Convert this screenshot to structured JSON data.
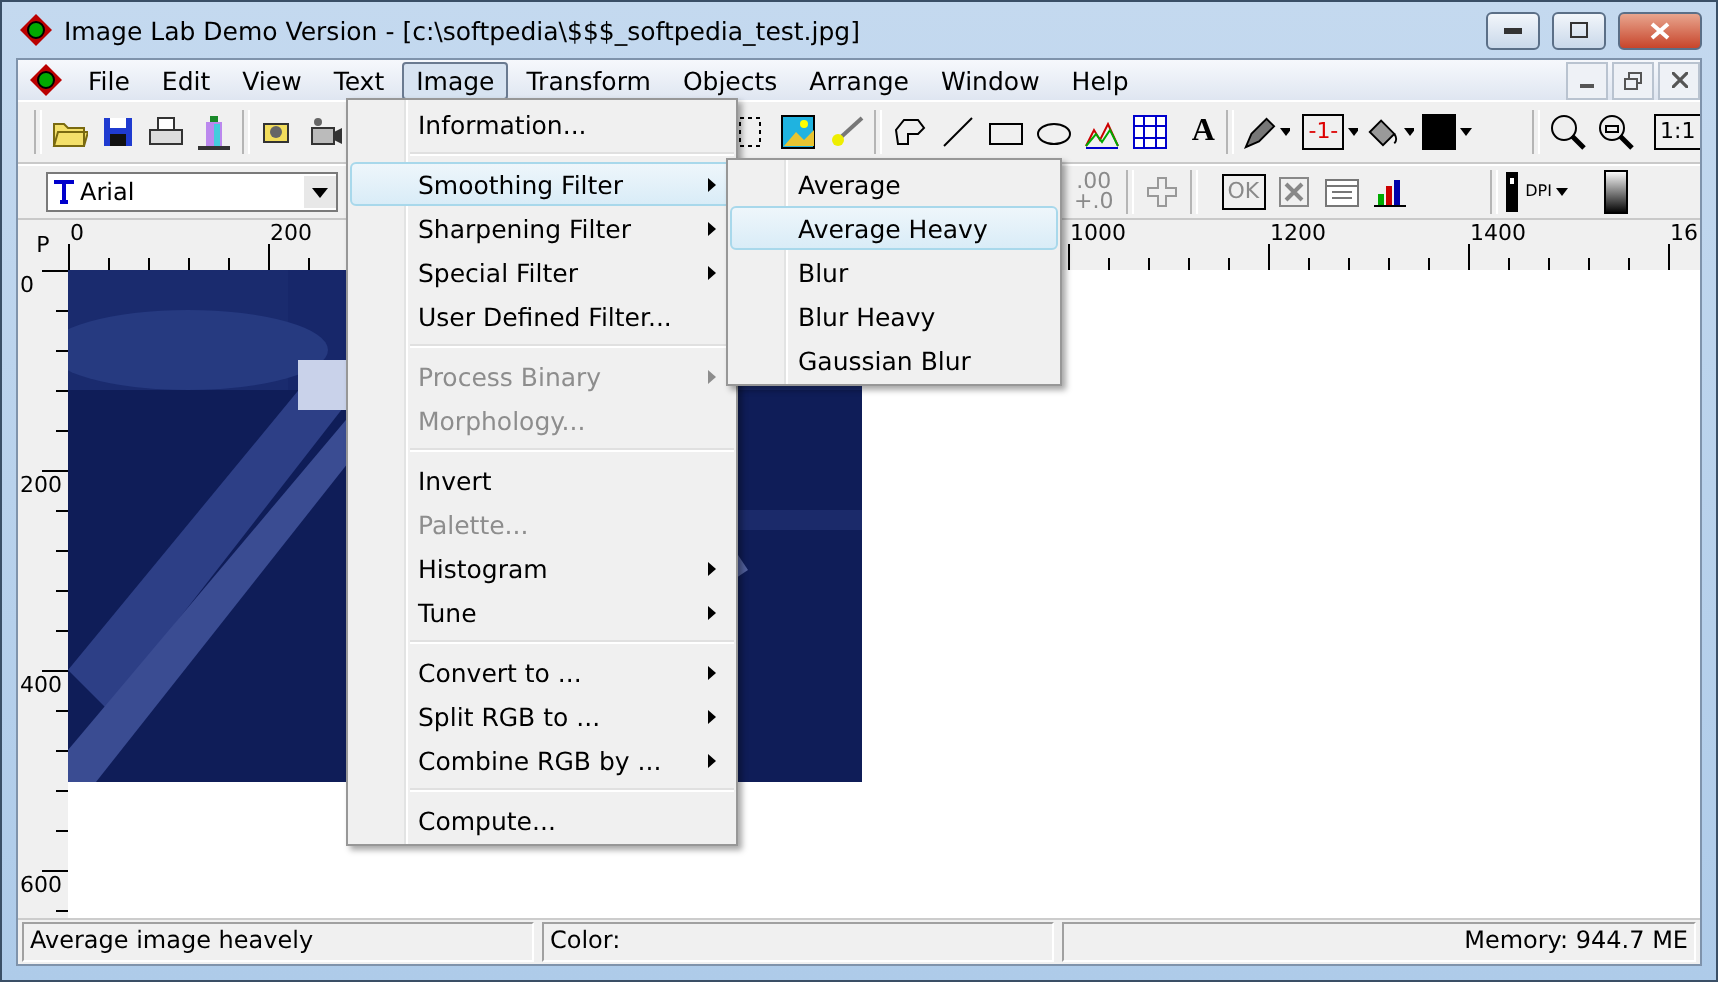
{
  "window": {
    "title": "Image Lab Demo Version - [c:\\softpedia\\$$$_softpedia_test.jpg]"
  },
  "menu_bar": [
    {
      "label": "File",
      "selected": false
    },
    {
      "label": "Edit",
      "selected": false
    },
    {
      "label": "View",
      "selected": false
    },
    {
      "label": "Text",
      "selected": false
    },
    {
      "label": "Image",
      "selected": true
    },
    {
      "label": "Transform",
      "selected": false
    },
    {
      "label": "Objects",
      "selected": false
    },
    {
      "label": "Arrange",
      "selected": false
    },
    {
      "label": "Window",
      "selected": false
    },
    {
      "label": "Help",
      "selected": false
    }
  ],
  "toolbar_top": [
    {
      "kind": "open"
    },
    {
      "kind": "save"
    },
    {
      "kind": "print"
    },
    {
      "kind": "scanner"
    },
    {
      "kind": "sep"
    },
    {
      "kind": "camera"
    },
    {
      "kind": "camcorder"
    },
    {
      "kind": "gap"
    },
    {
      "kind": "select"
    },
    {
      "kind": "picture"
    },
    {
      "kind": "wand"
    },
    {
      "kind": "sep"
    },
    {
      "kind": "lasso"
    },
    {
      "kind": "line"
    },
    {
      "kind": "rect"
    },
    {
      "kind": "ellipse"
    },
    {
      "kind": "histogram"
    },
    {
      "kind": "grid"
    },
    {
      "kind": "text",
      "label": "A"
    },
    {
      "kind": "sep"
    },
    {
      "kind": "pen",
      "dropdown": true
    },
    {
      "kind": "width",
      "label": "-1-",
      "dropdown": true
    },
    {
      "kind": "fill",
      "dropdown": true
    },
    {
      "kind": "swatch",
      "dropdown": true
    },
    {
      "kind": "grip"
    },
    {
      "kind": "zoomin"
    },
    {
      "kind": "zoomout"
    },
    {
      "kind": "actual",
      "label": "1:1"
    }
  ],
  "font_box": {
    "value": "Arial"
  },
  "toolbar_second": [
    {
      "kind": "decimal",
      "label": ".00 +.0"
    },
    {
      "kind": "grip"
    },
    {
      "kind": "cross"
    },
    {
      "kind": "sep"
    },
    {
      "kind": "ok",
      "label": "OK"
    },
    {
      "kind": "cancel"
    },
    {
      "kind": "window"
    },
    {
      "kind": "chart"
    },
    {
      "kind": "grip"
    },
    {
      "kind": "dpi",
      "label": "DPI",
      "dropdown": true
    },
    {
      "kind": "gradient"
    }
  ],
  "ruler": {
    "corner": "P",
    "top_labels": [
      "0",
      "200",
      "1000",
      "1200",
      "1400",
      "16"
    ],
    "left_labels": [
      "0",
      "200",
      "400",
      "600"
    ]
  },
  "image_menu": [
    {
      "kind": "item",
      "label": "Information...",
      "submenu": false,
      "disabled": false,
      "selected": false
    },
    {
      "kind": "separator"
    },
    {
      "kind": "item",
      "label": "Smoothing Filter",
      "submenu": true,
      "disabled": false,
      "selected": true
    },
    {
      "kind": "item",
      "label": "Sharpening Filter",
      "submenu": true,
      "disabled": false,
      "selected": false
    },
    {
      "kind": "item",
      "label": "Special Filter",
      "submenu": true,
      "disabled": false,
      "selected": false
    },
    {
      "kind": "item",
      "label": "User Defined Filter...",
      "submenu": false,
      "disabled": false,
      "selected": false
    },
    {
      "kind": "separator"
    },
    {
      "kind": "item",
      "label": "Process Binary",
      "submenu": true,
      "disabled": true,
      "selected": false
    },
    {
      "kind": "item",
      "label": "Morphology...",
      "submenu": false,
      "disabled": true,
      "selected": false
    },
    {
      "kind": "separator"
    },
    {
      "kind": "item",
      "label": "Invert",
      "submenu": false,
      "disabled": false,
      "selected": false
    },
    {
      "kind": "item",
      "label": "Palette...",
      "submenu": false,
      "disabled": true,
      "selected": false
    },
    {
      "kind": "item",
      "label": "Histogram",
      "submenu": true,
      "disabled": false,
      "selected": false
    },
    {
      "kind": "item",
      "label": "Tune",
      "submenu": true,
      "disabled": false,
      "selected": false
    },
    {
      "kind": "separator"
    },
    {
      "kind": "item",
      "label": "Convert to ...",
      "submenu": true,
      "disabled": false,
      "selected": false
    },
    {
      "kind": "item",
      "label": "Split RGB to ...",
      "submenu": true,
      "disabled": false,
      "selected": false
    },
    {
      "kind": "item",
      "label": "Combine RGB by ...",
      "submenu": true,
      "disabled": false,
      "selected": false
    },
    {
      "kind": "separator"
    },
    {
      "kind": "item",
      "label": "Compute...",
      "submenu": false,
      "disabled": false,
      "selected": false
    }
  ],
  "submenu": [
    {
      "label": "Average",
      "selected": false
    },
    {
      "label": "Average Heavy",
      "selected": true
    },
    {
      "label": "Blur",
      "selected": false
    },
    {
      "label": "Blur Heavy",
      "selected": false
    },
    {
      "label": "Gaussian Blur",
      "selected": false
    }
  ],
  "status_bar": [
    "Average image heavely",
    "Color:",
    "Memory: 944.7 ME"
  ]
}
